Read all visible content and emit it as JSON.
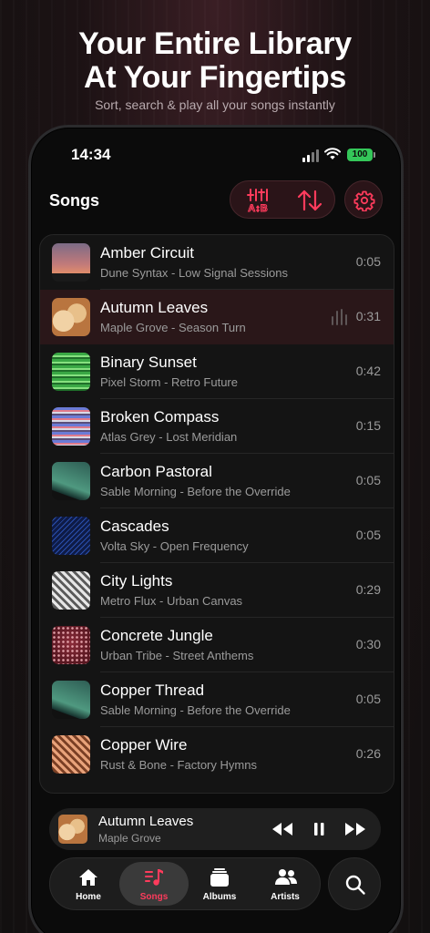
{
  "promo": {
    "headline_line1": "Your Entire Library",
    "headline_line2": "At Your Fingertips",
    "subline": "Sort, search & play all your songs instantly"
  },
  "status_bar": {
    "time": "14:34",
    "battery": "100"
  },
  "header": {
    "title": "Songs",
    "sort_alpha_icon": "sort-alpha-icon",
    "sort_order_icon": "sort-arrows-icon",
    "settings_icon": "gear-icon"
  },
  "colors": {
    "accent": "#ff3b5c",
    "background": "#0b0b0b",
    "row_active": "#2a1719"
  },
  "songs": [
    {
      "title": "Amber Circuit",
      "subtitle": "Dune Syntax - Low Signal Sessions",
      "duration": "0:05",
      "art": "gradient-dusk"
    },
    {
      "title": "Autumn Leaves",
      "subtitle": "Maple Grove - Season Turn",
      "duration": "0:31",
      "art": "brown-blobs",
      "playing": true
    },
    {
      "title": "Binary Sunset",
      "subtitle": "Pixel Storm - Retro Future",
      "duration": "0:42",
      "art": "green-stripes"
    },
    {
      "title": "Broken Compass",
      "subtitle": "Atlas Grey - Lost Meridian",
      "duration": "0:15",
      "art": "glitch-bands"
    },
    {
      "title": "Carbon Pastoral",
      "subtitle": "Sable Morning - Before the Override",
      "duration": "0:05",
      "art": "teal-gradient"
    },
    {
      "title": "Cascades",
      "subtitle": "Volta Sky - Open Frequency",
      "duration": "0:05",
      "art": "blue-lines"
    },
    {
      "title": "City Lights",
      "subtitle": "Metro Flux - Urban Canvas",
      "duration": "0:29",
      "art": "diagonal-grey"
    },
    {
      "title": "Concrete Jungle",
      "subtitle": "Urban Tribe - Street Anthems",
      "duration": "0:30",
      "art": "red-dots"
    },
    {
      "title": "Copper Thread",
      "subtitle": "Sable Morning - Before the Override",
      "duration": "0:05",
      "art": "teal-gradient"
    },
    {
      "title": "Copper Wire",
      "subtitle": "Rust & Bone - Factory Hymns",
      "duration": "0:26",
      "art": "copper-diagonal"
    }
  ],
  "now_playing": {
    "title": "Autumn Leaves",
    "artist": "Maple Grove",
    "controls": [
      "rewind-icon",
      "pause-icon",
      "fast-forward-icon"
    ]
  },
  "tabs": [
    {
      "label": "Home",
      "icon": "home-icon"
    },
    {
      "label": "Songs",
      "icon": "music-list-icon",
      "active": true
    },
    {
      "label": "Albums",
      "icon": "albums-icon"
    },
    {
      "label": "Artists",
      "icon": "artists-icon"
    }
  ],
  "search_icon": "search-icon"
}
